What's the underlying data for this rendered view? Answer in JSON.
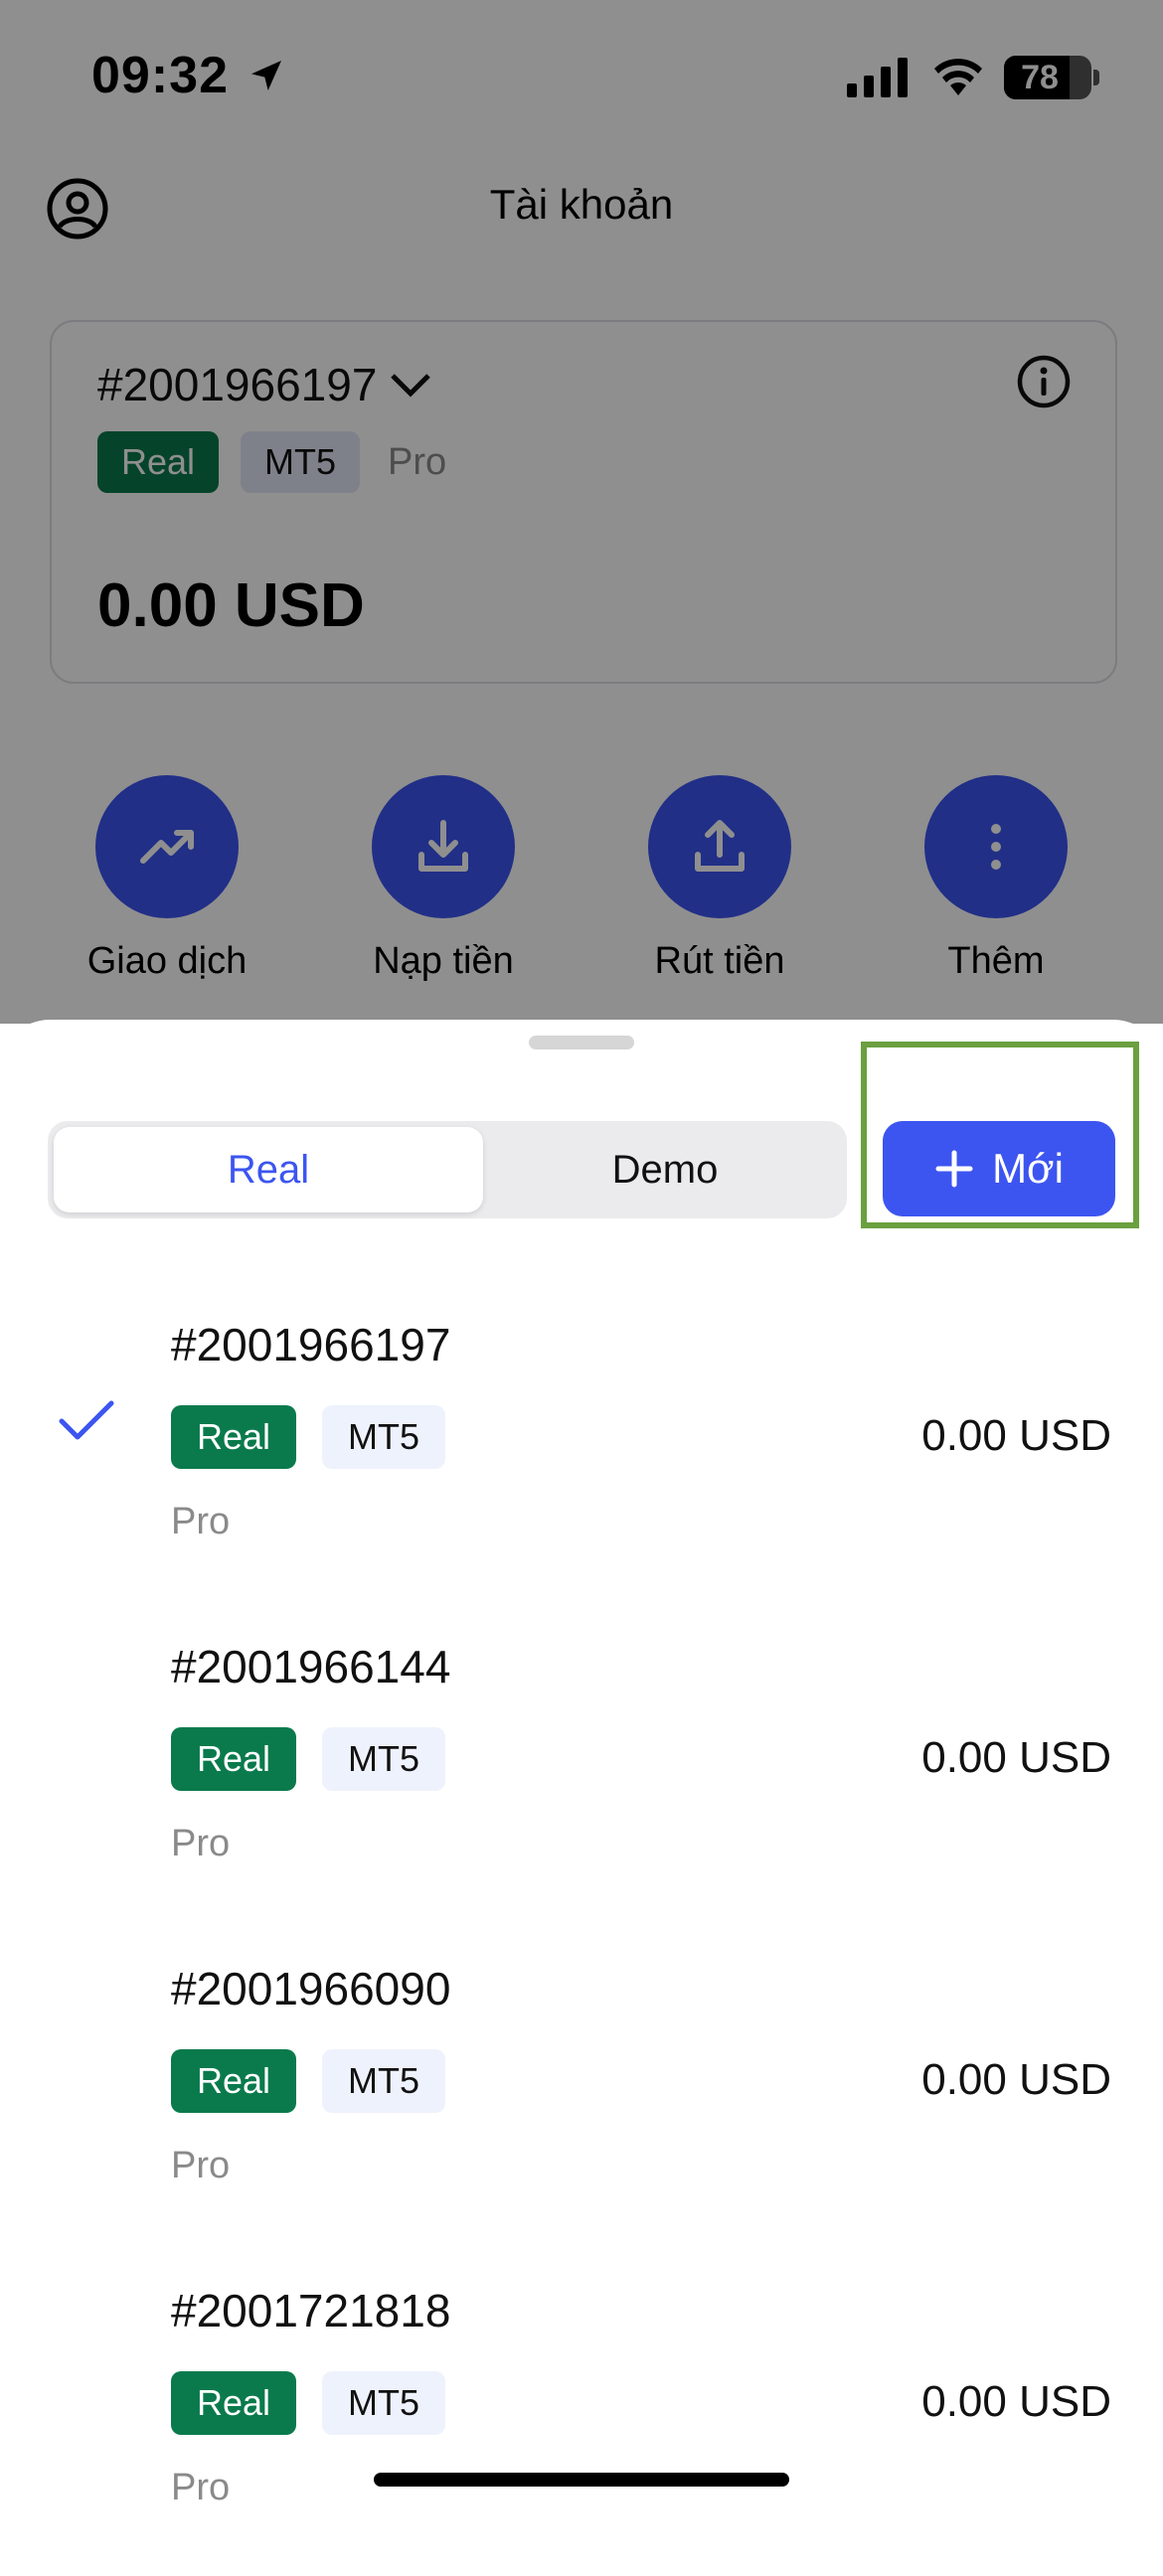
{
  "status_bar": {
    "time": "09:32",
    "battery": "78"
  },
  "header": {
    "title": "Tài khoản"
  },
  "account_card": {
    "id": "#2001966197",
    "tags": {
      "type": "Real",
      "platform": "MT5",
      "plan": "Pro"
    },
    "balance": "0.00 USD"
  },
  "actions": [
    {
      "label": "Giao dịch",
      "icon": "trend-up-icon"
    },
    {
      "label": "Nạp tiền",
      "icon": "download-icon"
    },
    {
      "label": "Rút tiền",
      "icon": "upload-icon"
    },
    {
      "label": "Thêm",
      "icon": "more-vertical-icon"
    }
  ],
  "sheet": {
    "segments": {
      "active": "Real",
      "inactive": "Demo"
    },
    "new_button": "Mới",
    "accounts": [
      {
        "id": "#2001966197",
        "type": "Real",
        "platform": "MT5",
        "plan": "Pro",
        "balance": "0.00 USD",
        "selected": true
      },
      {
        "id": "#2001966144",
        "type": "Real",
        "platform": "MT5",
        "plan": "Pro",
        "balance": "0.00 USD",
        "selected": false
      },
      {
        "id": "#2001966090",
        "type": "Real",
        "platform": "MT5",
        "plan": "Pro",
        "balance": "0.00 USD",
        "selected": false
      },
      {
        "id": "#2001721818",
        "type": "Real",
        "platform": "MT5",
        "plan": "Pro",
        "balance": "0.00 USD",
        "selected": false
      }
    ]
  },
  "colors": {
    "accent": "#3c55f0",
    "real_tag": "#0a7a4c",
    "highlight": "#6aa040"
  }
}
